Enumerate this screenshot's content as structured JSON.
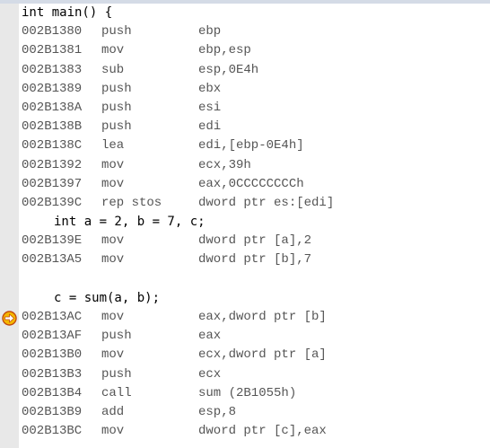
{
  "disassembly": {
    "func_header": "int main() {",
    "block1": [
      {
        "addr": "002B1380",
        "mnem": "push",
        "ops": "ebp"
      },
      {
        "addr": "002B1381",
        "mnem": "mov",
        "ops": "ebp,esp"
      },
      {
        "addr": "002B1383",
        "mnem": "sub",
        "ops": "esp,0E4h"
      },
      {
        "addr": "002B1389",
        "mnem": "push",
        "ops": "ebx"
      },
      {
        "addr": "002B138A",
        "mnem": "push",
        "ops": "esi"
      },
      {
        "addr": "002B138B",
        "mnem": "push",
        "ops": "edi"
      },
      {
        "addr": "002B138C",
        "mnem": "lea",
        "ops": "edi,[ebp-0E4h]"
      },
      {
        "addr": "002B1392",
        "mnem": "mov",
        "ops": "ecx,39h"
      },
      {
        "addr": "002B1397",
        "mnem": "mov",
        "ops": "eax,0CCCCCCCCh"
      },
      {
        "addr": "002B139C",
        "mnem": "rep stos",
        "ops": "dword ptr es:[edi]"
      }
    ],
    "src_decl": "int a = 2, b = 7, c;",
    "block2": [
      {
        "addr": "002B139E",
        "mnem": "mov",
        "ops": "dword ptr [a],2"
      },
      {
        "addr": "002B13A5",
        "mnem": "mov",
        "ops": "dword ptr [b],7"
      }
    ],
    "src_call": "c = sum(a, b);",
    "block3": [
      {
        "addr": "002B13AC",
        "mnem": "mov",
        "ops": "eax,dword ptr [b]"
      },
      {
        "addr": "002B13AF",
        "mnem": "push",
        "ops": "eax"
      },
      {
        "addr": "002B13B0",
        "mnem": "mov",
        "ops": "ecx,dword ptr [a]"
      },
      {
        "addr": "002B13B3",
        "mnem": "push",
        "ops": "ecx"
      },
      {
        "addr": "002B13B4",
        "mnem": "call",
        "ops": "sum (2B1055h)"
      },
      {
        "addr": "002B13B9",
        "mnem": "add",
        "ops": "esp,8"
      },
      {
        "addr": "002B13BC",
        "mnem": "mov",
        "ops": "dword ptr [c],eax"
      }
    ],
    "current_instruction_icon": "arrow-right-circle-icon"
  },
  "colors": {
    "gutter": "#e8e8e8",
    "address_text": "#555555",
    "source_text": "#000000",
    "marker_fill": "#f5b800",
    "marker_border": "#c24a0c"
  }
}
